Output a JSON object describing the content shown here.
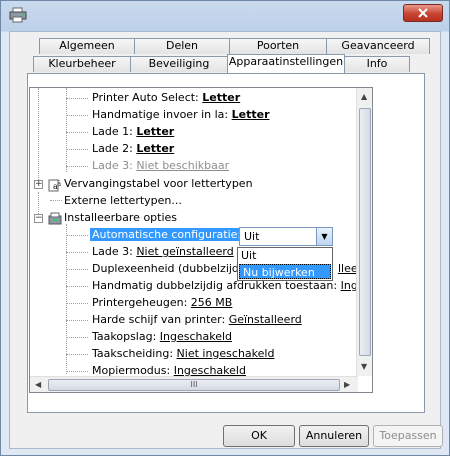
{
  "tabs_row_back": [
    "Algemeen",
    "Delen",
    "Poorten",
    "Geavanceerd"
  ],
  "tabs_row_front": [
    "Kleurbeheer",
    "Beveiliging",
    "Apparaatinstellingen",
    "Info"
  ],
  "active_tab": "Apparaatinstellingen",
  "tree": {
    "printer_auto_select": {
      "label": "Printer Auto Select:",
      "value": "Letter"
    },
    "manual_feed": {
      "label": "Handmatige invoer in la:",
      "value": "Letter"
    },
    "tray1": {
      "label": "Lade 1:",
      "value": "Letter"
    },
    "tray2": {
      "label": "Lade 2:",
      "value": "Letter"
    },
    "tray3": {
      "label": "Lade 3:",
      "value": "Niet beschikbaar"
    },
    "font_substitution": "Vervangingstabel voor lettertypen",
    "external_fonts": "Externe lettertypen...",
    "installable_options": "Installeerbare opties",
    "auto_config": {
      "label": "Automatische configuratie:"
    },
    "tray3_installed": {
      "label": "Lade 3:",
      "value": "Niet geïnstalleerd"
    },
    "duplex": {
      "label": "Duplexeenheid (dubbelzijdig",
      "value": "llee"
    },
    "manual_duplex": {
      "label": "Handmatig dubbelzijdig afdrukken toestaan:",
      "value": "Ingesch"
    },
    "printer_memory": {
      "label": "Printergeheugen:",
      "value": "256 MB"
    },
    "hard_disk": {
      "label": "Harde schijf van printer:",
      "value": "Geïnstalleerd"
    },
    "job_storage": {
      "label": "Taakopslag:",
      "value": "Ingeschakeld"
    },
    "job_separation": {
      "label": "Taakscheiding:",
      "value": "Niet ingeschakeld"
    },
    "mopier": {
      "label": "Mopiermodus:",
      "value": "Ingeschakeld"
    }
  },
  "combo": {
    "value": "Uit",
    "options": [
      "Uit",
      "Nu bijwerken"
    ],
    "highlighted": "Nu bijwerken"
  },
  "buttons": {
    "ok": "OK",
    "cancel": "Annuleren",
    "apply": "Toepassen"
  },
  "scroll_thumb_grip": "III",
  "colors": {
    "selection": "#3399ff",
    "close_button": "#c8432f"
  }
}
